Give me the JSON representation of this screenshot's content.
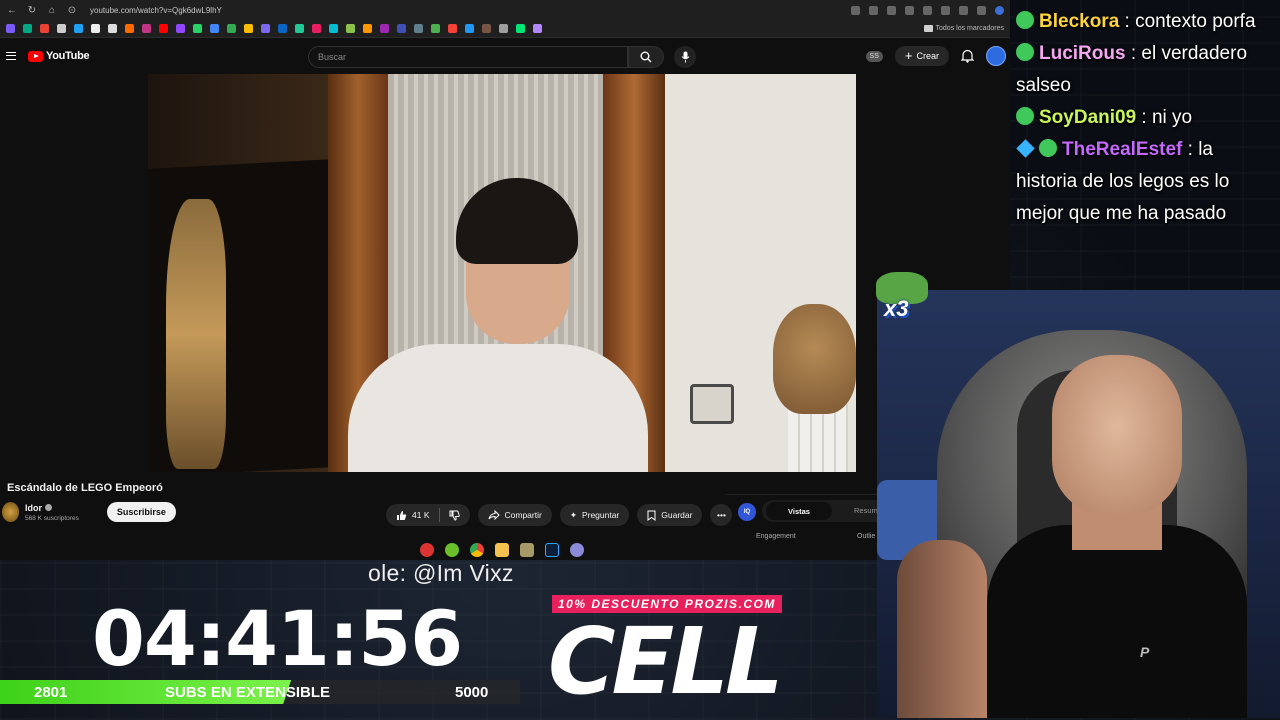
{
  "browser": {
    "url": "youtube.com/watch?v=Qgk6dwL9lhY",
    "bookmarks_folder": "Todos los marcadores"
  },
  "youtube": {
    "logo_text": "YouTube",
    "search_placeholder": "Buscar",
    "ss_badge": "SS",
    "create_label": "Crear"
  },
  "video": {
    "title": "Escándalo de LEGO Empeoró",
    "channel_name": "Idor",
    "channel_subs": "568 K suscriptores",
    "subscribe_label": "Suscribirse",
    "like_count": "41 K",
    "share_label": "Compartir",
    "ask_label": "Preguntar",
    "save_label": "Guardar"
  },
  "iq_panel": {
    "logo": "IQ",
    "tab_views": "Vistas",
    "tab_summary": "Resum",
    "engagement_label": "Engagement",
    "outliers_label": "Outlie"
  },
  "overlay": {
    "credit": "ole: @Im Vixz",
    "timer": "04:41:56",
    "subs_current": "2801",
    "subs_label": "SUBS EN EXTENSIBLE",
    "subs_goal": "5000",
    "subs_progress": 0.56,
    "promo": "10% DESCUENTO PROZIS.COM",
    "brand": "CELL",
    "emote_multiplier": "x3",
    "webcam_logo": "P"
  },
  "chat": [
    {
      "user": "Bleckora",
      "text": " : contexto porfa",
      "color": "#ffd43b"
    },
    {
      "user": "LuciRous",
      "text": " : el verdadero salseo",
      "color": "#f7a6f2"
    },
    {
      "user": "SoyDani09",
      "text": " : ni yo",
      "color": "#c9f55b"
    },
    {
      "user": "TheRealEstef",
      "text": " : la historia de los legos es lo mejor que me ha pasado",
      "color": "#c468ff"
    }
  ],
  "colors": {
    "youtube_red": "#ff0000",
    "progress_green": "#3ed11a",
    "promo_pink": "#e8205c"
  }
}
